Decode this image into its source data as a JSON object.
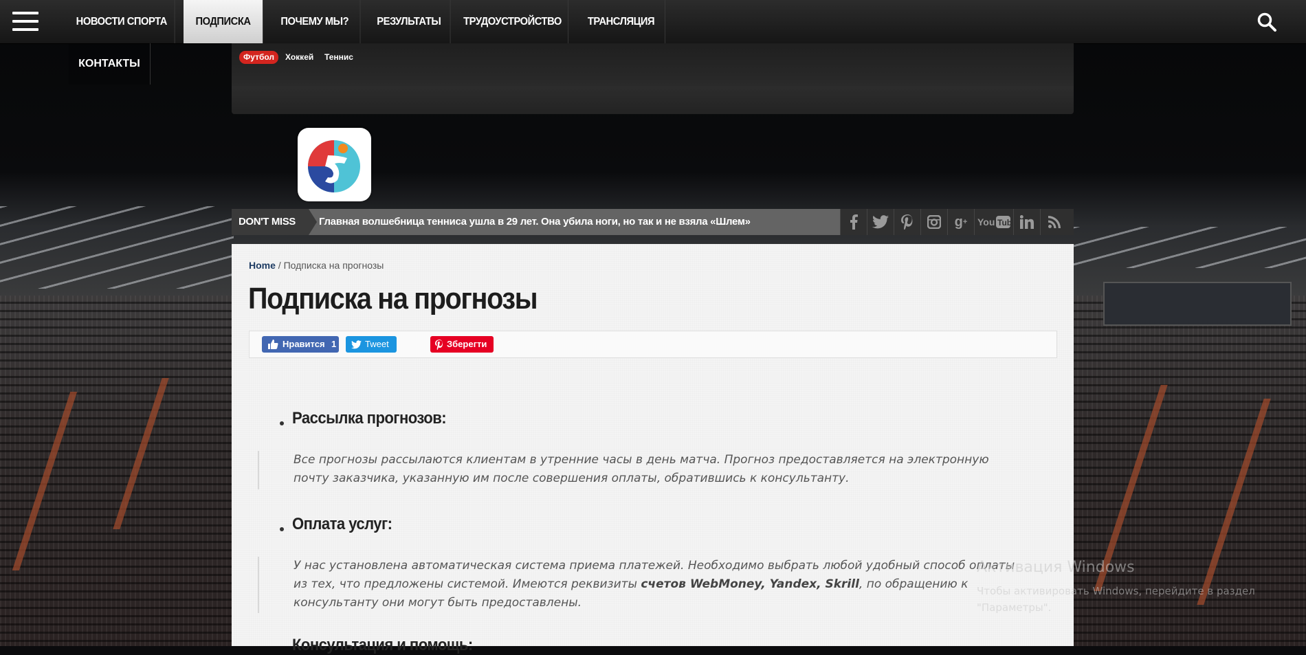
{
  "topnav": {
    "items": [
      "НОВОСТИ СПОРТА",
      "ПОДПИСКА",
      "ПОЧЕМУ МЫ?",
      "РЕЗУЛЬТАТЫ",
      "ТРУДОУСТРОЙСТВО",
      "ТРАНСЛЯЦИЯ"
    ],
    "active": "ПОДПИСКА",
    "second_row": "КОНТАКТЫ"
  },
  "sports_tabs": {
    "items": [
      "Футбол",
      "Хоккей",
      "Теннис"
    ],
    "active": "Футбол"
  },
  "ticker": {
    "label": "DON'T MISS",
    "headline": "Главная волшебница тенниса ушла в 29 лет. Она убила ноги, но так и не взяла «Шлем»"
  },
  "social_icons": [
    "facebook-icon",
    "twitter-icon",
    "pinterest-icon",
    "instagram-icon",
    "google-plus-icon",
    "youtube-icon",
    "linkedin-icon",
    "rss-icon"
  ],
  "breadcrumb": {
    "home": "Home",
    "separator": " / ",
    "current": "Подписка на прогнозы"
  },
  "page": {
    "title": "Подписка на прогнозы"
  },
  "share": {
    "like_label": "Нравится",
    "like_count": "1",
    "tweet_label": "Tweet",
    "pin_label": "Зберегти"
  },
  "sections": [
    {
      "heading": "Рассылка прогнозов:",
      "text": "Все прогнозы рассылаются клиентам в утренние часы в день матча. Прогноз предоставляется на электронную почту заказчика, указанную им после совершения оплаты, обратившись к консультанту."
    },
    {
      "heading": "Оплата услуг:",
      "text_before": "У нас установлена автоматическая система приема платежей. Необходимо выбрать любой удобный способ оплаты из тех, что предложены системой. Имеются реквизиты ",
      "text_bold": "счетов WebMoney, Yandex, Skrill",
      "text_after": ", по обращению к консультанту они могут быть предоставлены."
    },
    {
      "heading": "Консультация и помощь:"
    }
  ],
  "windows_watermark": {
    "title": "Активация Windows",
    "text": "Чтобы активировать Windows, перейдите в раздел \"Параметры\"."
  },
  "colors": {
    "accent_red": "#d3251f",
    "facebook": "#4267b2",
    "twitter": "#1b95e0",
    "pinterest": "#e60023",
    "link_navy": "#1e3c63"
  }
}
